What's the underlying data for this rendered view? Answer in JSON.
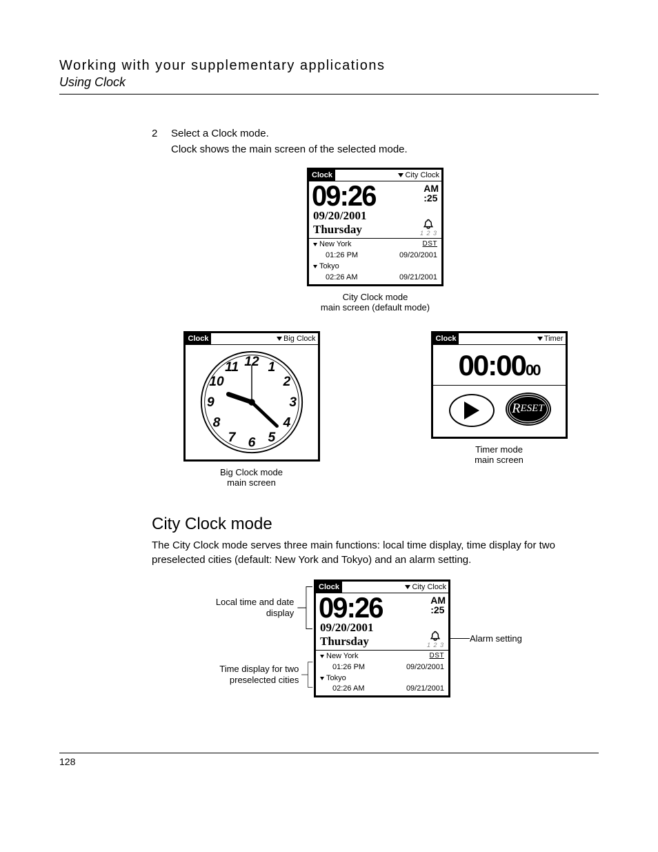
{
  "header": {
    "title": "Working with your supplementary applications",
    "subtitle": "Using Clock"
  },
  "step": {
    "number": "2",
    "instruction": "Select a Clock mode.",
    "result": "Clock shows the main screen of the selected mode."
  },
  "cityClockScreen": {
    "app": "Clock",
    "modeLabel": "City Clock",
    "time": "09:26",
    "ampm": "AM",
    "seconds": ":25",
    "date": "09/20/2001",
    "day": "Thursday",
    "silkNums": "1 2 3",
    "cities": [
      {
        "name": "New York",
        "dst": "DST",
        "time": "01:26 PM",
        "date": "09/20/2001"
      },
      {
        "name": "Tokyo",
        "dst": "",
        "time": "02:26 AM",
        "date": "09/21/2001"
      }
    ]
  },
  "captions": {
    "city1": "City Clock mode",
    "city2": "main screen (default mode)",
    "big1": "Big Clock mode",
    "big2": "main screen",
    "timer1": "Timer mode",
    "timer2": "main screen"
  },
  "bigClockScreen": {
    "app": "Clock",
    "modeLabel": "Big Clock"
  },
  "timerScreen": {
    "app": "Clock",
    "modeLabel": "Timer",
    "time": "00:00",
    "sub": "00",
    "resetLetter": "R",
    "resetRest": "ESET"
  },
  "section": {
    "heading": "City Clock mode",
    "para": "The City Clock mode serves three main functions: local time display, time display for two preselected cities (default: New York and Tokyo) and an alarm setting."
  },
  "annotations": {
    "localTime": "Local time and date display",
    "twoCities": "Time display for two preselected cities",
    "alarm": "Alarm setting"
  },
  "pageNumber": "128"
}
